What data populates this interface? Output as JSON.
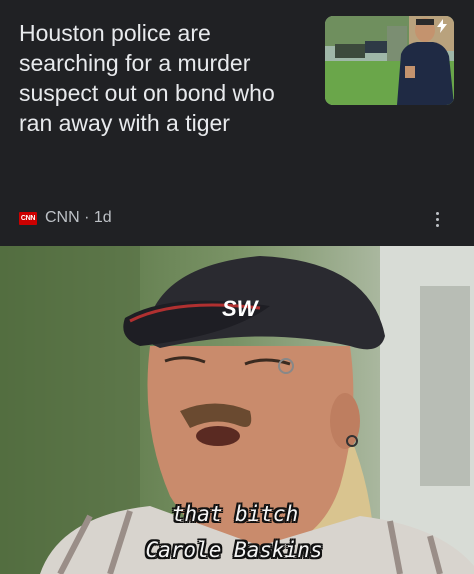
{
  "card": {
    "headline": "Houston police are searching for a murder suspect out on bond who ran away with a tiger",
    "source_logo": "CNN",
    "source": "CNN · 1d",
    "thumbnail_badge_icon": "lightning-bolt-icon",
    "more_icon": "more-vertical-icon"
  },
  "meme": {
    "cap_text": "SW",
    "caption_line1": "that bitch",
    "caption_line2": "Carole Baskins"
  },
  "colors": {
    "background": "#202124",
    "headline_text": "#e8eaed",
    "secondary_text": "#bdc1c6",
    "cnn_red": "#cc0000"
  }
}
